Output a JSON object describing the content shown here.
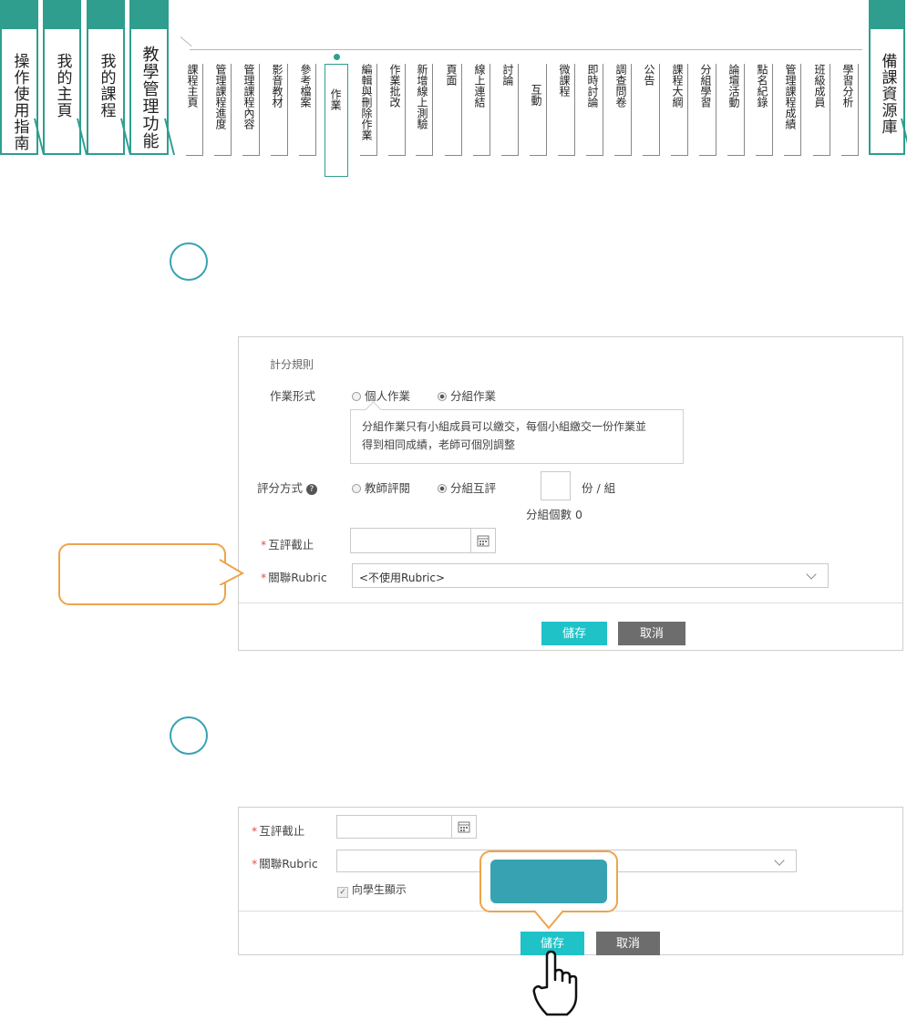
{
  "main_tabs": [
    {
      "label": "操作使用指南"
    },
    {
      "label": "我的主頁"
    },
    {
      "label": "我的課程"
    },
    {
      "label": "教學管理功能"
    }
  ],
  "right_tab": {
    "label": "備課資源庫"
  },
  "sub_nav": {
    "items": [
      {
        "label": "課程主頁"
      },
      {
        "label": "管理課程進度"
      },
      {
        "label": "管理課程內容"
      },
      {
        "label": "影音教材"
      },
      {
        "label": "參考檔案"
      },
      {
        "label": "作業",
        "active": true
      },
      {
        "label": "編輯與刪除作業"
      },
      {
        "label": "作業批改"
      },
      {
        "label": "新增線上測驗"
      },
      {
        "label": "頁面"
      },
      {
        "label": "線上連結"
      },
      {
        "label": "討論"
      },
      {
        "label": "互動"
      },
      {
        "label": "微課程"
      },
      {
        "label": "即時討論"
      },
      {
        "label": "調查問卷"
      },
      {
        "label": "公告"
      },
      {
        "label": "課程大綱"
      },
      {
        "label": "分組學習"
      },
      {
        "label": "論壇活動"
      },
      {
        "label": "點名紀錄"
      },
      {
        "label": "管理課程成績"
      },
      {
        "label": "班級成員"
      },
      {
        "label": "學習分析"
      }
    ]
  },
  "panel1": {
    "section_title": "計分規則",
    "assignment_type_label": "作業形式",
    "type_options": [
      "個人作業",
      "分組作業"
    ],
    "tip_line1": "分組作業只有小組成員可以繳交，每個小組繳交一份作業並",
    "tip_line2": "得到相同成績，老師可個別調整",
    "grading_label": "評分方式",
    "grading_options": [
      "教師評閱",
      "分組互評"
    ],
    "per_group": "份 / 組",
    "group_count": "分組個數 0",
    "peer_deadline_label": "互評截止",
    "rubric_label": "關聯Rubric",
    "rubric_value": "<不使用Rubric>",
    "save_label": "儲存",
    "cancel_label": "取消"
  },
  "panel2": {
    "peer_deadline_label": "互評截止",
    "rubric_label": "關聯Rubric",
    "show_students_label": "向學生顯示",
    "save_label": "儲存",
    "cancel_label": "取消"
  },
  "colors": {
    "accent": "#2f9e8f",
    "save_button": "#1fc2c7",
    "cancel_button": "#6d6d6d",
    "callout_border": "#eda44b",
    "step_circle": "#37a3b2"
  },
  "icons": [
    "calendar-icon",
    "chevron-down-icon",
    "question-icon",
    "hand-pointer-icon"
  ]
}
